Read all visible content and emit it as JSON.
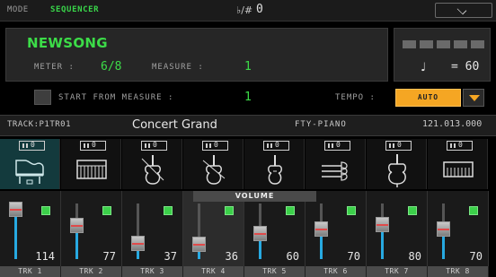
{
  "header": {
    "mode_label": "MODE",
    "mode_value": "SEQUENCER",
    "transpose_symbol": "♭/#",
    "transpose_value": "0",
    "menu_icon": "chevron-down-icon"
  },
  "song": {
    "name": "NEWSONG",
    "meter_label": "METER :",
    "meter_value": "6/8",
    "measure_label": "MEASURE :",
    "measure_value": "1"
  },
  "tempo": {
    "note_symbol": "♩",
    "equals_value": "=  60",
    "start_from_label": "START FROM MEASURE :",
    "start_from_value": "1",
    "tempo_label": "TEMPO :",
    "mode_value": "AUTO"
  },
  "track_info": {
    "track": "TRACK:P1TR01",
    "sound": "Concert Grand",
    "bank": "FTY-PIANO",
    "program": "121.013.000"
  },
  "tiles": [
    {
      "num": "0",
      "icon": "grand-piano-icon"
    },
    {
      "num": "0",
      "icon": "keyboard-icon"
    },
    {
      "num": "0",
      "icon": "violin-icon"
    },
    {
      "num": "0",
      "icon": "violin-icon"
    },
    {
      "num": "0",
      "icon": "viola-icon"
    },
    {
      "num": "0",
      "icon": "string-section-icon"
    },
    {
      "num": "0",
      "icon": "cello-icon"
    },
    {
      "num": "0",
      "icon": "keyboard-icon"
    }
  ],
  "mixer": {
    "section_label": "VOLUME",
    "channels": [
      {
        "label": "TRK 1",
        "volume": "114",
        "level": 0.9
      },
      {
        "label": "TRK 2",
        "volume": "77",
        "level": 0.61
      },
      {
        "label": "TRK 3",
        "volume": "37",
        "level": 0.29
      },
      {
        "label": "TRK 4",
        "volume": "36",
        "level": 0.28
      },
      {
        "label": "TRK 5",
        "volume": "60",
        "level": 0.47
      },
      {
        "label": "TRK 6",
        "volume": "70",
        "level": 0.55
      },
      {
        "label": "TRK 7",
        "volume": "80",
        "level": 0.63
      },
      {
        "label": "TRK 8",
        "volume": "70",
        "level": 0.55
      }
    ]
  },
  "colors": {
    "accent_green": "#3cdc48",
    "auto_orange": "#f5a623",
    "fader_blue": "#27a9e1",
    "selected_tile": "#133a3d"
  }
}
